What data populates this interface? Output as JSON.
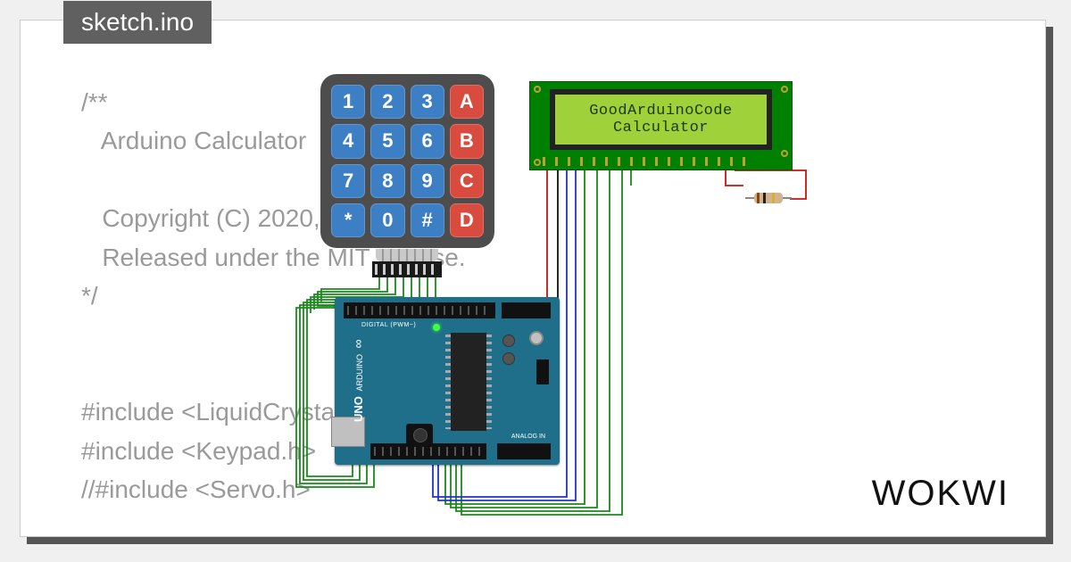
{
  "tab": {
    "label": "sketch.ino"
  },
  "code": {
    "text": "/**\n   Arduino Calculator\n\n   Copyright (C) 2020, U\n   Released under the MIT       nse.\n*/\n\n\n#include <LiquidCrysta\n#include <Keypad.h>\n//#include <Servo.h>"
  },
  "logo": {
    "text": "WOKWI"
  },
  "lcd": {
    "line1": "GoodArduinoCode",
    "line2": "Calculator"
  },
  "keypad": {
    "keys": [
      {
        "label": "1",
        "color": "blue"
      },
      {
        "label": "2",
        "color": "blue"
      },
      {
        "label": "3",
        "color": "blue"
      },
      {
        "label": "A",
        "color": "red"
      },
      {
        "label": "4",
        "color": "blue"
      },
      {
        "label": "5",
        "color": "blue"
      },
      {
        "label": "6",
        "color": "blue"
      },
      {
        "label": "B",
        "color": "red"
      },
      {
        "label": "7",
        "color": "blue"
      },
      {
        "label": "8",
        "color": "blue"
      },
      {
        "label": "9",
        "color": "blue"
      },
      {
        "label": "C",
        "color": "red"
      },
      {
        "label": "*",
        "color": "blue"
      },
      {
        "label": "0",
        "color": "blue"
      },
      {
        "label": "#",
        "color": "blue"
      },
      {
        "label": "D",
        "color": "red"
      }
    ]
  },
  "arduino": {
    "name": "UNO",
    "brand": "ARDUINO",
    "label_pwm": "DIGITAL (PWM~)",
    "label_analog": "ANALOG IN"
  },
  "wires": {
    "green": [
      "M112 228 L112 241 L47 241 L47 255",
      "M121 228 L121 244 L43 244 L43 260 L74 260",
      "M130 228 L130 247 L39 247 L39 264",
      "M139 228 L139 250 L35 250 L35 268",
      "M148 228 L148 253 L31 253 L31 451 L82 451 L82 438",
      "M157 228 L157 256 L27 256 L27 455 L90 455 L90 438",
      "M166 228 L166 259 L23 259 L23 459 L98 459 L98 438",
      "M175 228 L175 262 L19 262 L19 463 L106 463 L106 438",
      "M342 108 L342 482 L186 482 L186 438",
      "M356 108 L356 486 L192 486 L192 438",
      "M370 108 L370 490 L198 490 L198 438",
      "M384 108 L384 494 L204 494 L204 438",
      "M394 108 L394 125"
    ],
    "blue": [
      "M322 108 L322 474 L172 474 L172 438",
      "M332 108 L332 478 L178 478 L178 438"
    ],
    "red": [
      "M300 108 L300 320 L184 320",
      "M500 108 L500 125 L520 125",
      "M572 140 L590 140 L590 108 L510 108"
    ],
    "black": [
      "M312 108 L312 326 L184 326"
    ]
  }
}
